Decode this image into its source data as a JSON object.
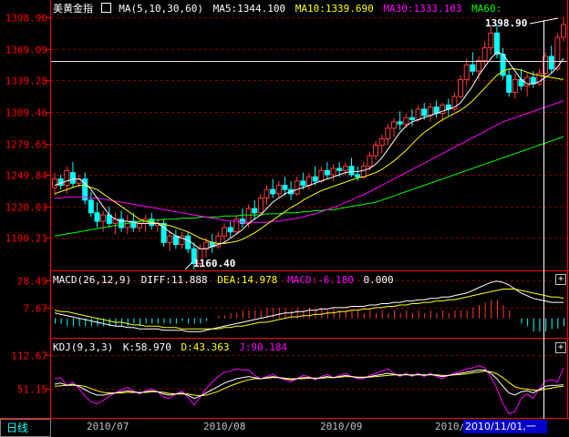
{
  "main": {
    "title": "美黄金指",
    "ma_def": "MA(5,10,30,60)",
    "ma5": "MA5:1344.100",
    "ma10": "MA10:1339.690",
    "ma30": "MA30:1333.103",
    "ma60": "MA60:",
    "high_label": "1398.90",
    "low_label": "1160.40",
    "y_ticks": [
      "1398.90",
      "1369.09",
      "1339.28",
      "1309.46",
      "1279.65",
      "1249.84",
      "1220.03",
      "1190.21"
    ]
  },
  "macd": {
    "label": "MACD(26,12,9)",
    "diff": "DIFF:11.888",
    "dea": "DEA:14.978",
    "macd": "MACD:-6.180",
    "extra": "0.000",
    "y_ticks": [
      "28.49",
      "7.67"
    ]
  },
  "kdj": {
    "label": "KDJ(9,3,3)",
    "k": "K:58.970",
    "d": "D:43.363",
    "j": "J:90.184",
    "y_ticks": [
      "112.67",
      "51.15"
    ]
  },
  "footer": {
    "period": "日线",
    "dates": [
      "2010/07",
      "2010/08",
      "2010/09",
      "2010/"
    ],
    "cursor_date": "2010/11/01,一"
  },
  "colors": {
    "up": "#ff3a3a",
    "down": "#00ffff",
    "ma5": "#ffffff",
    "ma10": "#ffff00",
    "ma30": "#ff00ff",
    "ma60": "#00ff00",
    "axis": "#ff0000",
    "grid": "#800000"
  },
  "chart_data": {
    "type": "candlestick",
    "ylim": [
      1160.4,
      1398.9
    ],
    "y_ticks": [
      1398.9,
      1369.09,
      1339.28,
      1309.46,
      1279.65,
      1249.84,
      1220.03,
      1190.21
    ],
    "ohlc": [
      [
        1238,
        1252,
        1230,
        1246
      ],
      [
        1246,
        1250,
        1236,
        1240
      ],
      [
        1240,
        1258,
        1232,
        1254
      ],
      [
        1252,
        1262,
        1238,
        1242
      ],
      [
        1242,
        1250,
        1238,
        1246
      ],
      [
        1246,
        1252,
        1222,
        1226
      ],
      [
        1226,
        1234,
        1210,
        1214
      ],
      [
        1214,
        1224,
        1200,
        1206
      ],
      [
        1206,
        1216,
        1196,
        1212
      ],
      [
        1212,
        1220,
        1200,
        1204
      ],
      [
        1204,
        1214,
        1194,
        1208
      ],
      [
        1208,
        1216,
        1196,
        1200
      ],
      [
        1200,
        1212,
        1194,
        1206
      ],
      [
        1206,
        1214,
        1196,
        1200
      ],
      [
        1200,
        1208,
        1196,
        1204
      ],
      [
        1204,
        1212,
        1196,
        1208
      ],
      [
        1208,
        1214,
        1198,
        1202
      ],
      [
        1202,
        1208,
        1196,
        1204
      ],
      [
        1204,
        1208,
        1182,
        1186
      ],
      [
        1186,
        1196,
        1178,
        1192
      ],
      [
        1192,
        1198,
        1180,
        1184
      ],
      [
        1184,
        1196,
        1180,
        1192
      ],
      [
        1192,
        1196,
        1176,
        1180
      ],
      [
        1180,
        1186,
        1160.4,
        1166
      ],
      [
        1166,
        1184,
        1162,
        1180
      ],
      [
        1180,
        1190,
        1172,
        1186
      ],
      [
        1186,
        1194,
        1176,
        1182
      ],
      [
        1182,
        1196,
        1180,
        1192
      ],
      [
        1192,
        1204,
        1186,
        1200
      ],
      [
        1200,
        1206,
        1190,
        1196
      ],
      [
        1196,
        1212,
        1194,
        1208
      ],
      [
        1208,
        1218,
        1200,
        1204
      ],
      [
        1204,
        1222,
        1200,
        1218
      ],
      [
        1218,
        1226,
        1208,
        1214
      ],
      [
        1214,
        1232,
        1212,
        1228
      ],
      [
        1228,
        1240,
        1222,
        1236
      ],
      [
        1236,
        1246,
        1228,
        1232
      ],
      [
        1232,
        1244,
        1228,
        1240
      ],
      [
        1240,
        1248,
        1230,
        1236
      ],
      [
        1236,
        1244,
        1226,
        1232
      ],
      [
        1232,
        1248,
        1230,
        1244
      ],
      [
        1244,
        1252,
        1236,
        1240
      ],
      [
        1240,
        1252,
        1236,
        1248
      ],
      [
        1248,
        1258,
        1240,
        1244
      ],
      [
        1244,
        1258,
        1242,
        1254
      ],
      [
        1254,
        1262,
        1246,
        1250
      ],
      [
        1250,
        1260,
        1244,
        1256
      ],
      [
        1256,
        1262,
        1248,
        1254
      ],
      [
        1254,
        1262,
        1250,
        1258
      ],
      [
        1258,
        1266,
        1248,
        1250
      ],
      [
        1250,
        1258,
        1244,
        1248
      ],
      [
        1248,
        1262,
        1246,
        1258
      ],
      [
        1258,
        1272,
        1254,
        1268
      ],
      [
        1268,
        1282,
        1264,
        1278
      ],
      [
        1278,
        1288,
        1270,
        1284
      ],
      [
        1284,
        1298,
        1278,
        1294
      ],
      [
        1294,
        1304,
        1286,
        1300
      ],
      [
        1300,
        1310,
        1292,
        1298
      ],
      [
        1298,
        1308,
        1294,
        1304
      ],
      [
        1304,
        1312,
        1296,
        1302
      ],
      [
        1302,
        1316,
        1300,
        1312
      ],
      [
        1312,
        1318,
        1302,
        1306
      ],
      [
        1306,
        1318,
        1300,
        1314
      ],
      [
        1314,
        1320,
        1304,
        1308
      ],
      [
        1308,
        1318,
        1300,
        1316
      ],
      [
        1316,
        1322,
        1306,
        1312
      ],
      [
        1312,
        1328,
        1310,
        1324
      ],
      [
        1324,
        1344,
        1322,
        1340
      ],
      [
        1340,
        1360,
        1334,
        1354
      ],
      [
        1354,
        1366,
        1344,
        1348
      ],
      [
        1348,
        1362,
        1340,
        1358
      ],
      [
        1358,
        1376,
        1352,
        1370
      ],
      [
        1370,
        1390,
        1364,
        1384
      ],
      [
        1384,
        1392,
        1360,
        1364
      ],
      [
        1364,
        1370,
        1340,
        1344
      ],
      [
        1344,
        1350,
        1324,
        1328
      ],
      [
        1328,
        1346,
        1322,
        1340
      ],
      [
        1340,
        1350,
        1330,
        1334
      ],
      [
        1334,
        1346,
        1324,
        1342
      ],
      [
        1342,
        1348,
        1332,
        1336
      ],
      [
        1336,
        1350,
        1334,
        1346
      ],
      [
        1346,
        1366,
        1344,
        1362
      ],
      [
        1362,
        1372,
        1346,
        1350
      ],
      [
        1350,
        1384,
        1348,
        1380
      ],
      [
        1380,
        1398.9,
        1376,
        1392
      ]
    ],
    "ma5": [
      1240,
      1242,
      1244,
      1246,
      1246,
      1242,
      1236,
      1228,
      1220,
      1212,
      1208,
      1206,
      1206,
      1205,
      1204,
      1204,
      1204,
      1204,
      1200,
      1196,
      1192,
      1190,
      1188,
      1184,
      1180,
      1180,
      1182,
      1184,
      1186,
      1190,
      1194,
      1198,
      1204,
      1208,
      1212,
      1218,
      1224,
      1228,
      1232,
      1234,
      1236,
      1238,
      1240,
      1242,
      1244,
      1246,
      1248,
      1250,
      1252,
      1253,
      1253,
      1254,
      1256,
      1260,
      1266,
      1274,
      1282,
      1290,
      1296,
      1300,
      1302,
      1304,
      1306,
      1308,
      1310,
      1312,
      1314,
      1318,
      1326,
      1334,
      1344,
      1352,
      1360,
      1366,
      1364,
      1356,
      1348,
      1340,
      1336,
      1336,
      1338,
      1342,
      1346,
      1352,
      1360
    ],
    "ma10": [
      1232,
      1234,
      1236,
      1238,
      1240,
      1240,
      1238,
      1236,
      1232,
      1228,
      1224,
      1220,
      1216,
      1212,
      1208,
      1206,
      1205,
      1204,
      1203,
      1202,
      1200,
      1198,
      1196,
      1193,
      1190,
      1188,
      1186,
      1185,
      1185,
      1186,
      1187,
      1189,
      1192,
      1195,
      1199,
      1203,
      1207,
      1211,
      1215,
      1219,
      1222,
      1226,
      1229,
      1232,
      1235,
      1237,
      1239,
      1241,
      1243,
      1245,
      1247,
      1248,
      1250,
      1252,
      1255,
      1259,
      1263,
      1268,
      1273,
      1279,
      1285,
      1290,
      1294,
      1298,
      1302,
      1305,
      1308,
      1311,
      1315,
      1320,
      1326,
      1332,
      1338,
      1344,
      1348,
      1350,
      1350,
      1349,
      1347,
      1345,
      1344,
      1343,
      1342,
      1341,
      1340
    ],
    "ma30": [
      1228,
      1228,
      1229,
      1229,
      1229,
      1229,
      1228,
      1228,
      1227,
      1226,
      1225,
      1224,
      1223,
      1222,
      1221,
      1220,
      1219,
      1218,
      1217,
      1216,
      1215,
      1214,
      1213,
      1212,
      1211,
      1210,
      1209,
      1208,
      1207,
      1206,
      1206,
      1205,
      1205,
      1205,
      1205,
      1205,
      1206,
      1206,
      1207,
      1208,
      1209,
      1210,
      1212,
      1213,
      1215,
      1217,
      1219,
      1221,
      1224,
      1226,
      1229,
      1231,
      1234,
      1237,
      1240,
      1243,
      1246,
      1249,
      1252,
      1255,
      1258,
      1261,
      1264,
      1267,
      1270,
      1273,
      1276,
      1279,
      1282,
      1285,
      1288,
      1291,
      1294,
      1297,
      1300,
      1302,
      1304,
      1306,
      1308,
      1310,
      1312,
      1314,
      1316,
      1318,
      1320
    ],
    "ma60": [
      1192,
      1193,
      1194,
      1195,
      1196,
      1197,
      1198,
      1199,
      1200,
      1201,
      1202,
      1203,
      1204,
      1205,
      1206,
      1206,
      1207,
      1207,
      1208,
      1208,
      1208,
      1209,
      1209,
      1209,
      1210,
      1210,
      1210,
      1210,
      1211,
      1211,
      1211,
      1212,
      1212,
      1212,
      1212,
      1213,
      1213,
      1213,
      1214,
      1214,
      1214,
      1215,
      1215,
      1216,
      1216,
      1217,
      1217,
      1218,
      1219,
      1220,
      1221,
      1222,
      1223,
      1224,
      1226,
      1228,
      1230,
      1232,
      1234,
      1236,
      1238,
      1240,
      1242,
      1244,
      1246,
      1248,
      1250,
      1252,
      1254,
      1256,
      1258,
      1260,
      1262,
      1264,
      1266,
      1268,
      1270,
      1272,
      1274,
      1276,
      1278,
      1280,
      1282,
      1284,
      1286
    ],
    "macd_ylim": [
      -14,
      34
    ],
    "macd_ticks": [
      28.49,
      7.67
    ],
    "diff": [
      4,
      3,
      2,
      1,
      0,
      -1,
      -2,
      -3,
      -4,
      -5,
      -6,
      -6,
      -7,
      -7,
      -8,
      -8,
      -8,
      -8,
      -9,
      -9,
      -9,
      -9,
      -10,
      -10,
      -10,
      -9,
      -8,
      -7,
      -6,
      -5,
      -4,
      -3,
      -2,
      -1,
      0,
      1,
      2,
      3,
      4,
      4,
      5,
      5,
      6,
      6,
      7,
      7,
      8,
      8,
      8,
      9,
      9,
      9,
      10,
      10,
      11,
      11,
      12,
      12,
      13,
      13,
      14,
      14,
      15,
      15,
      16,
      16,
      17,
      18,
      19,
      21,
      23,
      25,
      27,
      28,
      27,
      25,
      22,
      19,
      17,
      15,
      14,
      13,
      12,
      12,
      12
    ],
    "dea": [
      6,
      5,
      5,
      4,
      3,
      2,
      1,
      0,
      -1,
      -2,
      -3,
      -3,
      -4,
      -5,
      -5,
      -6,
      -6,
      -6,
      -7,
      -7,
      -7,
      -8,
      -8,
      -8,
      -8,
      -8,
      -8,
      -8,
      -7,
      -7,
      -6,
      -6,
      -5,
      -4,
      -3,
      -3,
      -2,
      -1,
      0,
      1,
      1,
      2,
      2,
      3,
      3,
      4,
      4,
      5,
      5,
      6,
      6,
      7,
      7,
      8,
      8,
      9,
      9,
      10,
      10,
      11,
      11,
      12,
      12,
      13,
      13,
      14,
      14,
      15,
      16,
      17,
      18,
      19,
      20,
      21,
      22,
      22,
      22,
      21,
      20,
      19,
      18,
      17,
      16,
      16,
      15
    ],
    "macd": [
      -4,
      -4,
      -6,
      -6,
      -6,
      -6,
      -6,
      -6,
      -6,
      -6,
      -6,
      -6,
      -6,
      -4,
      -6,
      -4,
      -4,
      -4,
      -4,
      -4,
      -4,
      -2,
      -4,
      -4,
      -4,
      -2,
      0,
      2,
      2,
      4,
      4,
      6,
      6,
      6,
      6,
      8,
      8,
      8,
      8,
      6,
      8,
      6,
      8,
      6,
      8,
      6,
      8,
      6,
      6,
      6,
      6,
      4,
      6,
      4,
      6,
      4,
      6,
      4,
      6,
      4,
      6,
      4,
      6,
      4,
      6,
      4,
      6,
      6,
      6,
      8,
      10,
      12,
      14,
      14,
      10,
      6,
      0,
      -4,
      -6,
      -10,
      -10,
      -10,
      -8,
      -8,
      -6
    ],
    "kdj_ylim": [
      0,
      140
    ],
    "kdj_ticks": [
      112.67,
      51.15
    ],
    "k": [
      60,
      62,
      58,
      60,
      56,
      50,
      44,
      40,
      40,
      42,
      44,
      46,
      48,
      46,
      44,
      46,
      48,
      46,
      42,
      40,
      42,
      44,
      40,
      34,
      38,
      44,
      50,
      56,
      62,
      66,
      70,
      72,
      74,
      72,
      70,
      72,
      74,
      72,
      70,
      68,
      70,
      72,
      72,
      70,
      72,
      74,
      72,
      74,
      76,
      74,
      72,
      72,
      74,
      76,
      78,
      80,
      78,
      76,
      78,
      76,
      78,
      76,
      78,
      76,
      74,
      76,
      78,
      80,
      82,
      84,
      86,
      86,
      80,
      70,
      56,
      44,
      40,
      46,
      48,
      44,
      50,
      56,
      58,
      58,
      59
    ],
    "d": [
      56,
      57,
      58,
      58,
      58,
      56,
      52,
      48,
      45,
      44,
      44,
      44,
      45,
      45,
      45,
      45,
      46,
      46,
      45,
      43,
      42,
      42,
      42,
      40,
      39,
      40,
      43,
      47,
      52,
      57,
      61,
      65,
      68,
      70,
      70,
      71,
      72,
      72,
      71,
      70,
      70,
      70,
      71,
      71,
      71,
      72,
      72,
      73,
      74,
      74,
      73,
      73,
      73,
      74,
      75,
      76,
      77,
      77,
      77,
      77,
      77,
      77,
      77,
      77,
      76,
      76,
      77,
      78,
      79,
      81,
      82,
      84,
      83,
      79,
      72,
      63,
      55,
      52,
      51,
      49,
      49,
      51,
      53,
      55,
      56
    ],
    "j": [
      70,
      72,
      58,
      64,
      52,
      38,
      28,
      24,
      30,
      38,
      44,
      50,
      54,
      48,
      42,
      48,
      52,
      46,
      36,
      34,
      42,
      48,
      36,
      22,
      36,
      52,
      64,
      74,
      82,
      84,
      88,
      86,
      86,
      76,
      70,
      74,
      78,
      72,
      68,
      64,
      70,
      76,
      74,
      68,
      74,
      78,
      72,
      76,
      80,
      74,
      70,
      70,
      76,
      80,
      84,
      88,
      80,
      74,
      80,
      74,
      80,
      74,
      80,
      74,
      70,
      76,
      80,
      84,
      88,
      90,
      94,
      90,
      74,
      52,
      24,
      6,
      10,
      34,
      42,
      34,
      52,
      66,
      68,
      64,
      90
    ]
  }
}
